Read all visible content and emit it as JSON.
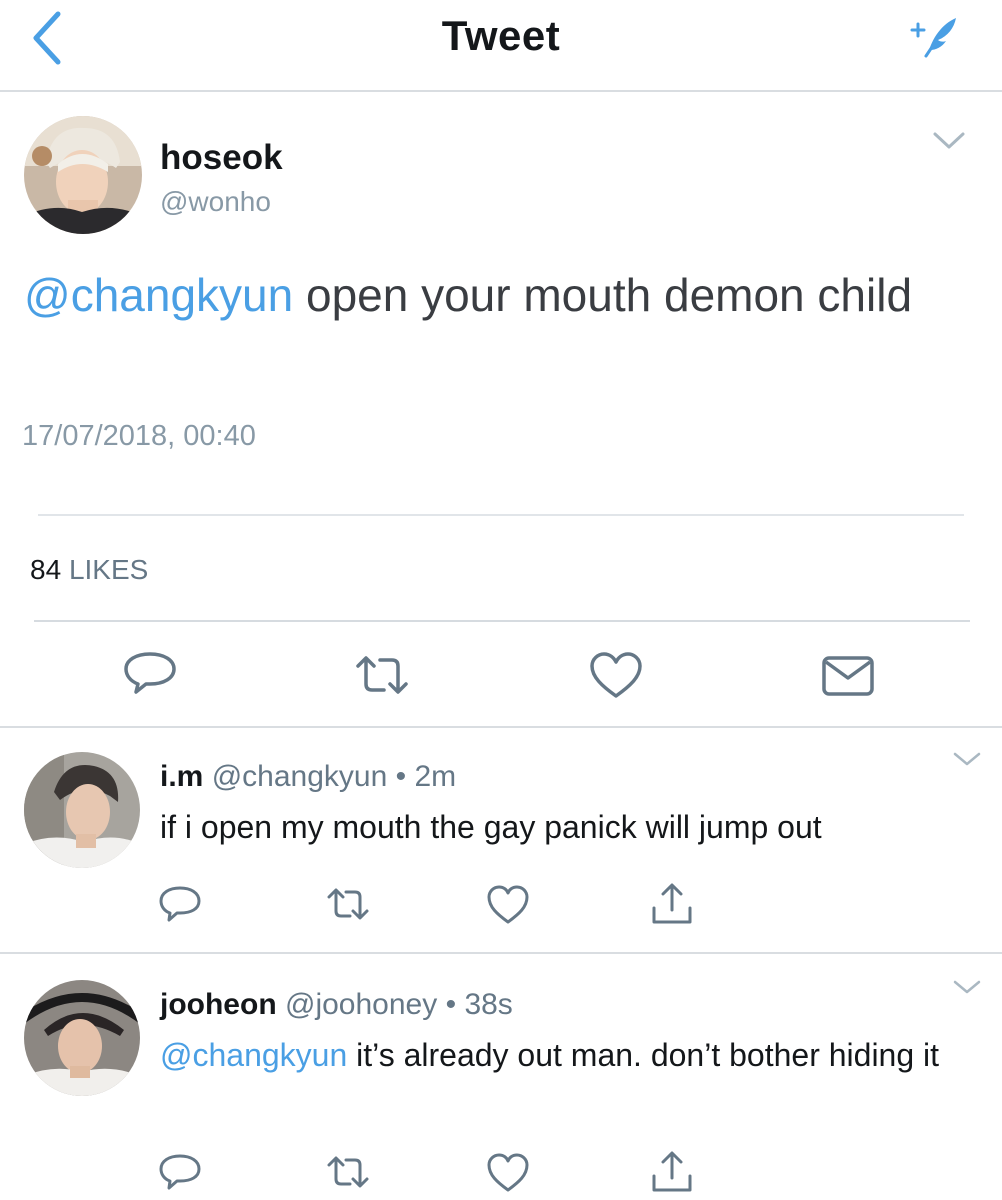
{
  "navbar": {
    "title": "Tweet",
    "back_icon": "chevron-left-icon",
    "compose_icon": "compose-tweet-icon",
    "accent_color": "#4a9fe4"
  },
  "main_tweet": {
    "name": "hoseok",
    "handle": "@wonho",
    "mention": "@changkyun",
    "text": " open your mouth demon child",
    "timestamp": "17/07/2018, 00:40",
    "likes_count": "84",
    "likes_label": "LIKES",
    "actions": [
      "reply-icon",
      "retweet-icon",
      "like-icon",
      "direct-message-icon"
    ]
  },
  "replies": [
    {
      "name": "i.m",
      "handle": "@changkyun",
      "dot": "•",
      "time": "2m",
      "mention": "",
      "text": "if i open my mouth the gay panick will jump out",
      "actions": [
        "reply-icon",
        "retweet-icon",
        "like-icon",
        "share-icon"
      ]
    },
    {
      "name": "jooheon",
      "handle": "@joohoney",
      "dot": "•",
      "time": "38s",
      "mention": "@changkyun",
      "text": " it’s already out man. don’t bother hiding it",
      "actions": [
        "reply-icon",
        "retweet-icon",
        "like-icon",
        "share-icon"
      ]
    }
  ],
  "colors": {
    "link_blue": "#4a9fe4",
    "secondary_gray": "#8899a6",
    "icon_gray": "#657786"
  }
}
